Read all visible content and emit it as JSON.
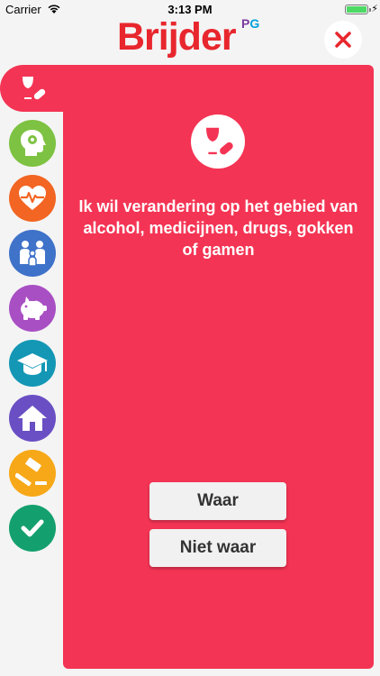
{
  "status_bar": {
    "carrier": "Carrier",
    "time": "3:13 PM"
  },
  "header": {
    "logo_text": "Brijder",
    "logo_badge_p": "P",
    "logo_badge_g": "G"
  },
  "colors": {
    "accent": "#f43454",
    "logo_red": "#e8262d"
  },
  "sidebar": {
    "items": [
      {
        "name": "alcohol-drugs",
        "icon": "glass-pill-icon",
        "color": "#f43454",
        "active": true
      },
      {
        "name": "mind",
        "icon": "head-brain-icon",
        "color": "#7dc242"
      },
      {
        "name": "health",
        "icon": "heart-pulse-icon",
        "color": "#f26522"
      },
      {
        "name": "relationships",
        "icon": "family-icon",
        "color": "#3f72c9"
      },
      {
        "name": "finances",
        "icon": "piggy-bank-icon",
        "color": "#a94fc4"
      },
      {
        "name": "education",
        "icon": "graduation-cap-icon",
        "color": "#1497b5"
      },
      {
        "name": "housing",
        "icon": "house-icon",
        "color": "#6a4fc4"
      },
      {
        "name": "justice",
        "icon": "gavel-icon",
        "color": "#f7a818"
      },
      {
        "name": "done",
        "icon": "checkmark-icon",
        "color": "#14a06e"
      }
    ]
  },
  "card": {
    "statement": "Ik wil verandering op het gebied van alcohol, medicijnen, drugs, gokken of gamen",
    "true_label": "Waar",
    "false_label": "Niet waar"
  }
}
